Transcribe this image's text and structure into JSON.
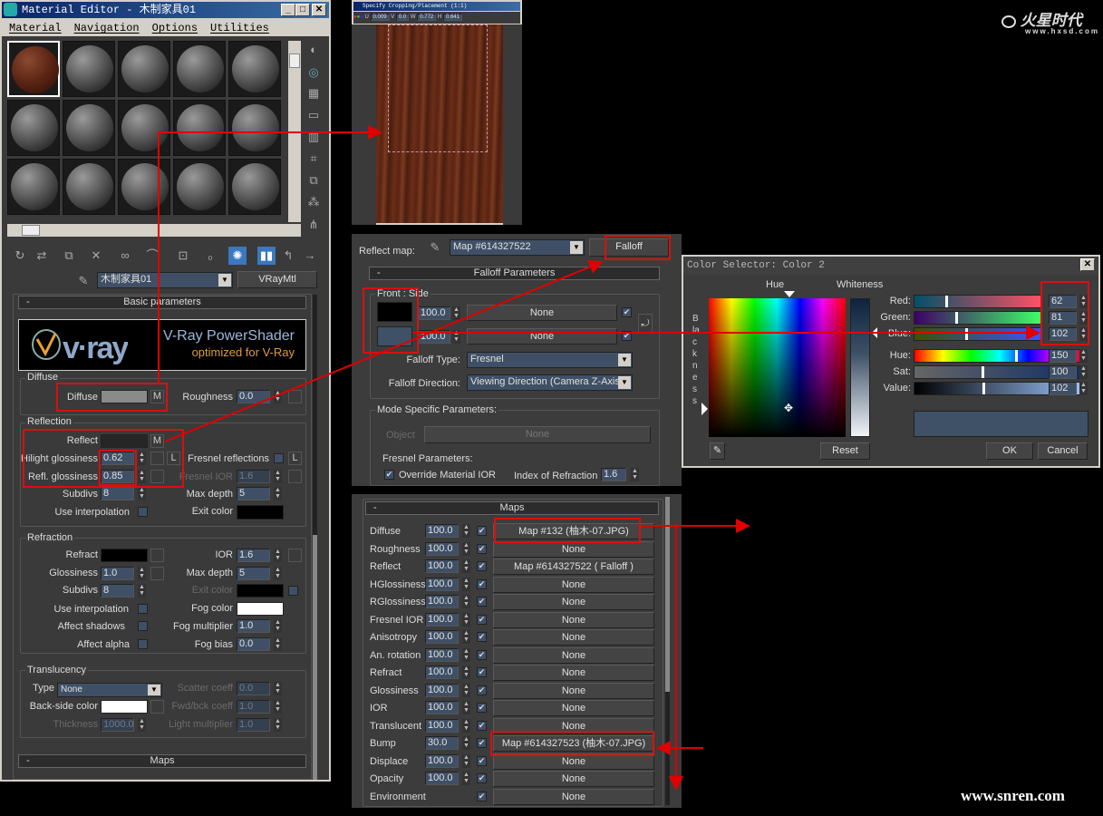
{
  "material_editor": {
    "title": "Material Editor - 木制家具01",
    "menu": [
      "Material",
      "Navigation",
      "Options",
      "Utilities"
    ],
    "material_name": "木制家具01",
    "material_type": "VRayMtl",
    "basic_params_header": "Basic parameters",
    "banner": {
      "line1": "V-Ray PowerShader",
      "line2": "optimized for V-Ray",
      "logo": "v·ray"
    },
    "diffuse": {
      "group": "Diffuse",
      "label": "Diffuse",
      "m": "M",
      "roughness_label": "Roughness",
      "roughness": "0.0",
      "color": "#8a8a8a"
    },
    "reflection": {
      "group": "Reflection",
      "reflect_label": "Reflect",
      "m": "M",
      "hilight_label": "Hilight glossiness",
      "hilight": "0.62",
      "l": "L",
      "refl_gloss_label": "Refl. glossiness",
      "refl_gloss": "0.85",
      "subdivs_label": "Subdivs",
      "subdivs": "8",
      "use_interp_label": "Use interpolation",
      "fresnel_label": "Fresnel reflections",
      "fresnel_ior_label": "Fresnel IOR",
      "fresnel_ior": "1.6",
      "max_depth_label": "Max depth",
      "max_depth": "5",
      "exit_color_label": "Exit color"
    },
    "refraction": {
      "group": "Refraction",
      "refract_label": "Refract",
      "gloss_label": "Glossiness",
      "gloss": "1.0",
      "subdivs_label": "Subdivs",
      "subdivs": "8",
      "use_interp_label": "Use interpolation",
      "affect_shadows_label": "Affect shadows",
      "affect_alpha_label": "Affect alpha",
      "ior_label": "IOR",
      "ior": "1.6",
      "max_depth_label": "Max depth",
      "max_depth": "5",
      "exit_color_label": "Exit color",
      "fog_color_label": "Fog color",
      "fog_mult_label": "Fog multiplier",
      "fog_mult": "1.0",
      "fog_bias_label": "Fog bias",
      "fog_bias": "0.0"
    },
    "translucency": {
      "group": "Translucency",
      "type_label": "Type",
      "type": "None",
      "backside_label": "Back-side color",
      "thickness_label": "Thickness",
      "thickness": "1000.0",
      "scatter_label": "Scatter coeff",
      "scatter": "0.0",
      "fwd_label": "Fwd/bck coeff",
      "fwd": "1.0",
      "light_mult_label": "Light multiplier",
      "light_mult": "1.0"
    },
    "maps_header": "Maps"
  },
  "crop_window": {
    "title": "Specify Cropping/Placement (1:1)",
    "u": "0.009",
    "v": "0.0",
    "w": "0.772",
    "h": "0.641"
  },
  "falloff": {
    "reflect_map_label": "Reflect map:",
    "map_name": "Map #614327522",
    "type_button": "Falloff",
    "header": "Falloff Parameters",
    "front_side_label": "Front : Side",
    "front_amount": "100.0",
    "side_amount": "100.0",
    "front_map": "None",
    "side_map": "None",
    "front_color": "#000000",
    "side_color": "#3e5166",
    "falloff_type_label": "Falloff Type:",
    "falloff_type": "Fresnel",
    "falloff_dir_label": "Falloff Direction:",
    "falloff_dir": "Viewing Direction (Camera Z-Axis)",
    "mode_label": "Mode Specific Parameters:",
    "object_label": "Object",
    "object_value": "None",
    "fresnel_params_label": "Fresnel Parameters:",
    "override_label": "Override Material IOR",
    "ior_label": "Index of Refraction",
    "ior": "1.6"
  },
  "color_selector": {
    "title": "Color Selector: Color 2",
    "hue_label": "Hue",
    "whiteness_label": "Whiteness",
    "blackness_label": "Blackness",
    "sliders": [
      {
        "label": "Red:",
        "value": "62",
        "fraction": 0.243
      },
      {
        "label": "Green:",
        "value": "81",
        "fraction": 0.318
      },
      {
        "label": "Blue:",
        "value": "102",
        "fraction": 0.4
      },
      {
        "label": "Hue:",
        "value": "150",
        "fraction": 0.588
      },
      {
        "label": "Sat:",
        "value": "100",
        "fraction": 0.392
      },
      {
        "label": "Value:",
        "value": "102",
        "fraction": 0.4
      }
    ],
    "preview_color": "#3e5166",
    "reset": "Reset",
    "ok": "OK",
    "cancel": "Cancel"
  },
  "maps": {
    "header": "Maps",
    "rows": [
      {
        "label": "Diffuse",
        "amount": "100.0",
        "map": "Map #132 (柚木-07.JPG)"
      },
      {
        "label": "Roughness",
        "amount": "100.0",
        "map": "None"
      },
      {
        "label": "Reflect",
        "amount": "100.0",
        "map": "Map #614327522  ( Falloff )"
      },
      {
        "label": "HGlossiness",
        "amount": "100.0",
        "map": "None"
      },
      {
        "label": "RGlossiness",
        "amount": "100.0",
        "map": "None"
      },
      {
        "label": "Fresnel IOR",
        "amount": "100.0",
        "map": "None"
      },
      {
        "label": "Anisotropy",
        "amount": "100.0",
        "map": "None"
      },
      {
        "label": "An. rotation",
        "amount": "100.0",
        "map": "None"
      },
      {
        "label": "Refract",
        "amount": "100.0",
        "map": "None"
      },
      {
        "label": "Glossiness",
        "amount": "100.0",
        "map": "None"
      },
      {
        "label": "IOR",
        "amount": "100.0",
        "map": "None"
      },
      {
        "label": "Translucent",
        "amount": "100.0",
        "map": "None"
      },
      {
        "label": "Bump",
        "amount": "30.0",
        "map": "Map #614327523 (柚木-07.JPG)"
      },
      {
        "label": "Displace",
        "amount": "100.0",
        "map": "None"
      },
      {
        "label": "Opacity",
        "amount": "100.0",
        "map": "None"
      },
      {
        "label": "Environment",
        "amount": null,
        "map": "None"
      }
    ]
  },
  "watermarks": {
    "logo": "火星时代",
    "logo_url": "www.hxsd.com",
    "footer": "www.snren.com"
  }
}
